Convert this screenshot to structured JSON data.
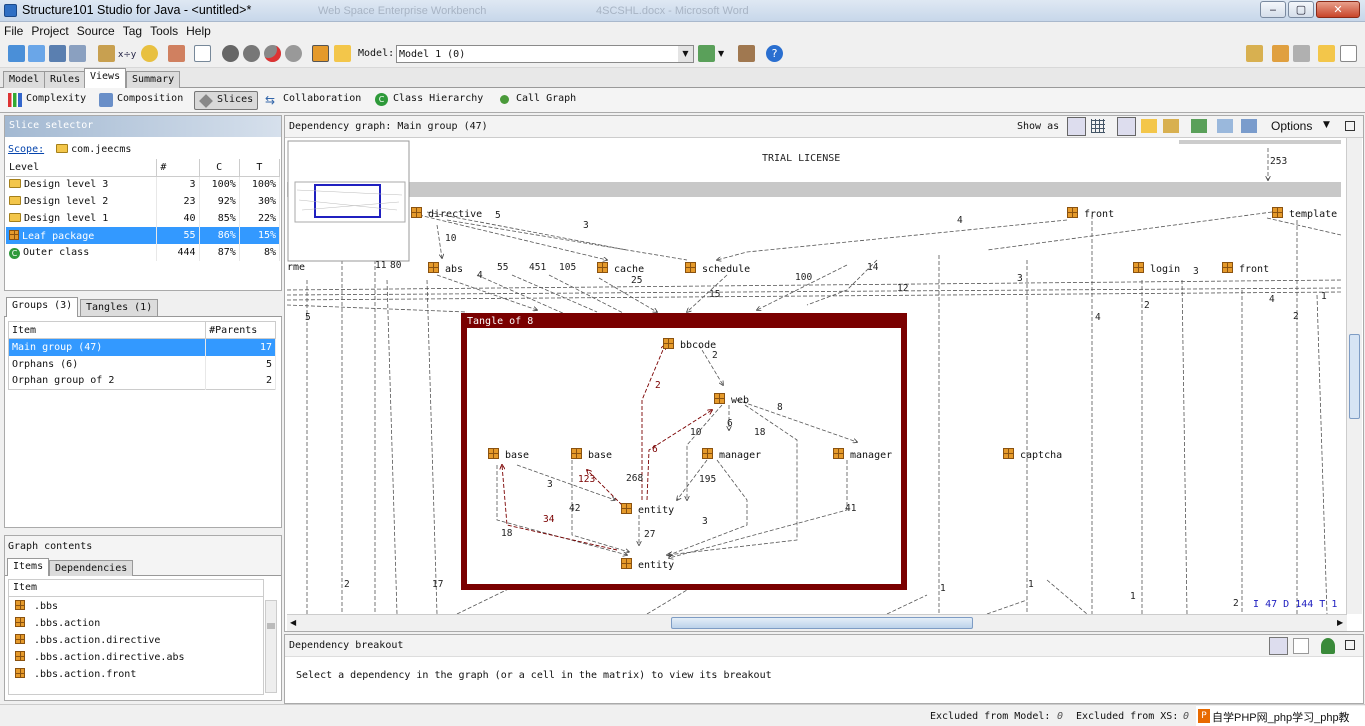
{
  "window": {
    "title": "Structure101 Studio for Java - <untitled>*",
    "ghost_title_1": "Web Space Enterprise Workbench",
    "ghost_title_2": "4SCSHL.docx - Microsoft Word",
    "btn_min": "‒",
    "btn_max": "▢",
    "btn_close": "✕"
  },
  "menu": {
    "file": "File",
    "project": "Project",
    "source": "Source",
    "tag": "Tag",
    "tools": "Tools",
    "help": "Help"
  },
  "toolbar": {
    "model_label": "Model:",
    "model_value": "Model 1 (0)"
  },
  "main_tabs": {
    "model": "Model",
    "rules": "Rules",
    "views": "Views",
    "summary": "Summary"
  },
  "views": {
    "complexity": "Complexity",
    "composition": "Composition",
    "slices": "Slices",
    "collaboration": "Collaboration",
    "class_hierarchy": "Class Hierarchy",
    "call_graph": "Call Graph"
  },
  "slice_selector": {
    "title": "Slice selector",
    "scope_label": "Scope:",
    "scope_value": "com.jeecms",
    "headers": {
      "level": "Level",
      "count": "#",
      "c": "C",
      "t": "T"
    },
    "rows": [
      {
        "level": "Design level 3",
        "count": "3",
        "c": "100%",
        "t": "100%"
      },
      {
        "level": "Design level 2",
        "count": "23",
        "c": "92%",
        "t": "30%"
      },
      {
        "level": "Design level 1",
        "count": "40",
        "c": "85%",
        "t": "22%"
      },
      {
        "level": "Leaf package",
        "count": "55",
        "c": "86%",
        "t": "15%"
      },
      {
        "level": "Outer class",
        "count": "444",
        "c": "87%",
        "t": "8%"
      }
    ]
  },
  "groups": {
    "tab_groups": "Groups (3)",
    "tab_tangles": "Tangles (1)",
    "header_item": "Item",
    "header_parents": "#Parents",
    "rows": [
      {
        "item": "Main group (47)",
        "parents": "17"
      },
      {
        "item": "Orphans (6)",
        "parents": "5"
      },
      {
        "item": "Orphan group of 2",
        "parents": "2"
      }
    ]
  },
  "graph_contents": {
    "title": "Graph contents",
    "tab_items": "Items",
    "tab_dependencies": "Dependencies",
    "header_item": "Item",
    "items": [
      ".bbs",
      ".bbs.action",
      ".bbs.action.directive",
      ".bbs.action.directive.abs",
      ".bbs.action.front"
    ]
  },
  "graph": {
    "title": "Dependency graph: Main group (47)",
    "show_as": "Show as",
    "options": "Options",
    "trial": "TRIAL LICENSE",
    "tangle_title": "Tangle of 8",
    "nodes": {
      "directive": "directive",
      "front1": "front",
      "template": "template",
      "rme": "rme",
      "abs": "abs",
      "cache": "cache",
      "schedule": "schedule",
      "login": "login",
      "front2": "front",
      "bbcode": "bbcode",
      "web": "web",
      "base1": "base",
      "base2": "base",
      "manager1": "manager",
      "manager2": "manager",
      "captcha": "captcha",
      "entity1": "entity",
      "entity2": "entity"
    },
    "edge_labels": {
      "e253": "253",
      "e5": "5",
      "e3a": "3",
      "e4a": "4",
      "e10": "10",
      "e11": "11",
      "e80": "80",
      "e4b": "4",
      "e55": "55",
      "e451": "451",
      "e105": "105",
      "e25": "25",
      "e15": "15",
      "e100": "100",
      "e14": "14",
      "e12": "12",
      "e3b": "3",
      "e3c": "3",
      "e2a": "2",
      "e4c": "4",
      "e4d": "4",
      "e2b": "2",
      "e1a": "1",
      "e5b": "5",
      "e2c": "2",
      "e8": "8",
      "e6a": "6",
      "e18a": "18",
      "e10b": "10",
      "e6b": "6",
      "e268": "268",
      "e123": "123",
      "e195": "195",
      "e3d": "3",
      "e42": "42",
      "e34": "34",
      "e18b": "18",
      "e3e": "3",
      "e27": "27",
      "e41": "41",
      "e2d": "2",
      "e17": "17",
      "e1b": "1",
      "e1c": "1",
      "e1d": "1",
      "e2e": "2"
    },
    "corner": {
      "i": "I",
      "i_val": "47",
      "d": "D",
      "d_val": "144",
      "t": "T",
      "t_val": "1"
    }
  },
  "breakout": {
    "title": "Dependency breakout",
    "message": "Select a dependency in the graph (or a cell in the matrix) to view its breakout"
  },
  "status": {
    "excluded_model": "Excluded from Model:",
    "excluded_model_val": "0",
    "excluded_xs": "Excluded from XS:",
    "excluded_xs_val": "0",
    "watermark": "自学PHP网_php学习_php教"
  }
}
